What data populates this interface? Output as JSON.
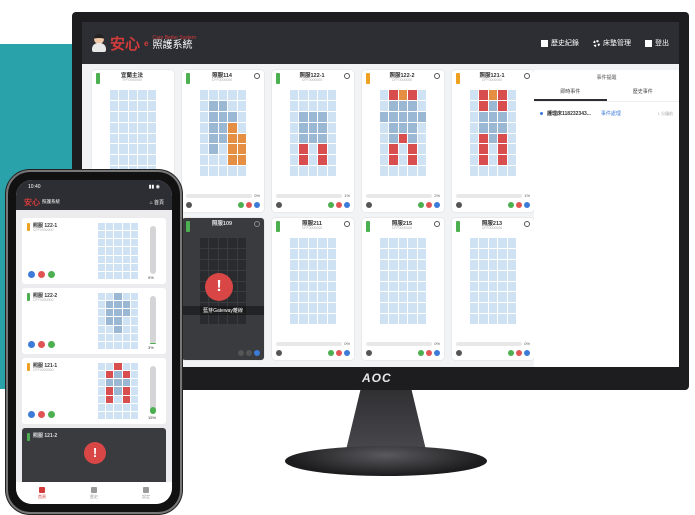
{
  "app": {
    "brand": "安心",
    "brand_suffix": "e",
    "brand_en": "Care Better System",
    "system_name": "照護系統"
  },
  "header_nav": [
    {
      "label": "歷史紀錄",
      "icon": "history-icon"
    },
    {
      "label": "床墊管理",
      "icon": "gear-icon"
    },
    {
      "label": "登出",
      "icon": "logout-icon"
    }
  ],
  "monitor_brand": "AOC",
  "cards": [
    {
      "title": "宜蘭主法",
      "serial": "TFF0000000",
      "battery": "green",
      "pct": "0%",
      "state": "online"
    },
    {
      "title": "照服114",
      "serial": "CFF0000000",
      "battery": "green",
      "pct": "0%",
      "state": "online"
    },
    {
      "title": "照服122-1",
      "serial": "CFF0000000",
      "battery": "green",
      "pct": "1%",
      "state": "online"
    },
    {
      "title": "照服122-2",
      "serial": "CFF0000000",
      "battery": "amber",
      "pct": "2%",
      "state": "online"
    },
    {
      "title": "照服121-1",
      "serial": "CFF0000000",
      "battery": "amber",
      "pct": "1%",
      "state": "online"
    },
    {
      "title": "照服109",
      "serial": "",
      "battery": "green",
      "pct": "",
      "state": "offline",
      "offline_text": "藍芽Gateway離線"
    },
    {
      "title": "照服211",
      "serial": "CFF0000000",
      "battery": "green",
      "pct": "0%",
      "state": "online"
    },
    {
      "title": "照服215",
      "serial": "CFF0000000",
      "battery": "green",
      "pct": "0%",
      "state": "online"
    },
    {
      "title": "照服213",
      "serial": "CFF0000000",
      "battery": "green",
      "pct": "0%",
      "state": "online"
    }
  ],
  "right_panel": {
    "title": "事件提醒",
    "tabs": [
      "即時事件",
      "歷史事件"
    ],
    "event": {
      "name": "護理床118232343...",
      "action": "事件處理",
      "time": "1 分鐘前"
    }
  },
  "phone": {
    "time": "10:40",
    "home_label": "首頁",
    "cards": [
      {
        "name": "照服 122-1",
        "serial": "CFF0000000",
        "battery": "amber",
        "value": "0%"
      },
      {
        "name": "照服 122-2",
        "serial": "CFF0000000",
        "battery": "green",
        "value": "3%"
      },
      {
        "name": "照服 121-1",
        "serial": "CFF0000000",
        "battery": "amber",
        "value": "15%"
      },
      {
        "name": "照服 121-2",
        "serial": "",
        "battery": "green",
        "value": ""
      }
    ],
    "tabs": [
      "首頁",
      "歷史",
      "設定"
    ]
  }
}
